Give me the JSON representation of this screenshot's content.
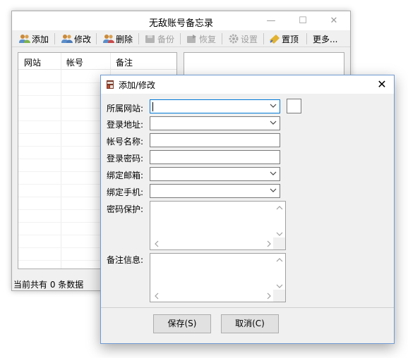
{
  "main_window": {
    "title": "无敌账号备忘录",
    "toolbar": {
      "add": "添加",
      "edit": "修改",
      "delete": "删除",
      "backup": "备份",
      "restore": "恢复",
      "settings": "设置",
      "top": "置顶",
      "more": "更多..."
    },
    "list_columns": [
      "网站",
      "帐号",
      "备注"
    ],
    "status_text": "当前共有 0 条数据"
  },
  "dialog": {
    "title": "添加/修改",
    "labels": {
      "site": "所属网站:",
      "login_url": "登录地址:",
      "account_name": "帐号名称:",
      "login_password": "登录密码:",
      "bound_email": "绑定邮箱:",
      "bound_phone": "绑定手机:",
      "password_protection": "密码保护:",
      "notes": "备注信息:"
    },
    "values": {
      "site": "",
      "login_url": "",
      "account_name": "",
      "login_password": "",
      "bound_email": "",
      "bound_phone": "",
      "password_protection": "",
      "notes": ""
    },
    "buttons": {
      "save": "保存(S)",
      "cancel": "取消(C)"
    }
  },
  "icons": [
    "users-icon",
    "edit-users-icon",
    "delete-users-icon",
    "backup-icon",
    "restore-icon",
    "settings-gear-icon",
    "pin-top-icon",
    "app-icon",
    "close-icon",
    "minimize-icon",
    "maximize-icon",
    "chevron-down-icon"
  ],
  "colors": {
    "accent_border": "#0078d7",
    "dialog_border": "#6f9ad3",
    "disabled_text": "#a0a0a0",
    "window_bg": "#f0f0f0"
  }
}
